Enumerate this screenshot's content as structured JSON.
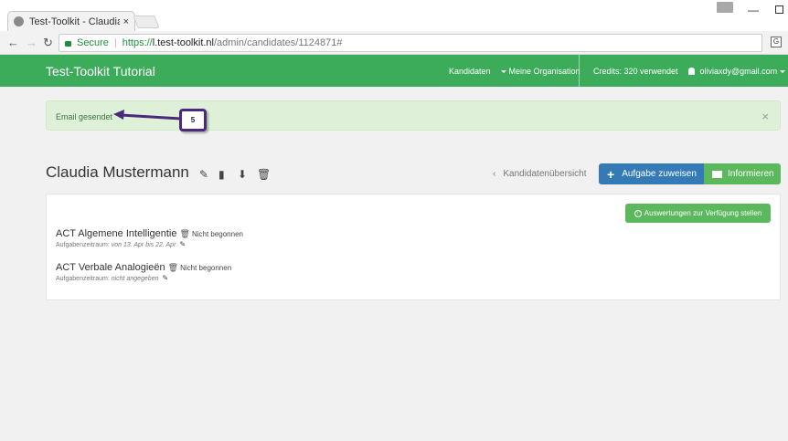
{
  "browser": {
    "tab_title": "Test-Toolkit - Claudia Mu",
    "tab_close": "×",
    "secure_label": "Secure",
    "url_protocol": "https://",
    "url_host": "l.test-toolkit.nl",
    "url_path": "/admin/candidates/1124871#",
    "translate_glyph": "G"
  },
  "navbar": {
    "brand": "Test-Toolkit Tutorial",
    "items": [
      "Kandidaten",
      "Meine Organisation"
    ],
    "credits": "Credits: 320 verwendet",
    "user": "oliviaxdy@gmail.com"
  },
  "alert": {
    "text": "Email gesendet",
    "close": "×"
  },
  "annotation": {
    "step": "5"
  },
  "candidate": {
    "name": "Claudia Mustermann",
    "back_label": "Kandidatenübersicht",
    "assign_label": "Aufgabe zuweisen",
    "inform_label": "Informieren"
  },
  "panel": {
    "eval_button": "Auswertungen zur Verfügung stellen",
    "tasks": [
      {
        "title": "ACT Algemene Intelligentie",
        "status": "Nicht begonnen",
        "period_label": "Aufgabenzeitraum:",
        "period_value": "von 13. Apr bis 22. Apr"
      },
      {
        "title": "ACT Verbale Analogieën",
        "status": "Nicht begonnen",
        "period_label": "Aufgabenzeitraum:",
        "period_value": "nicht angegeben"
      }
    ]
  },
  "colors": {
    "navbar": "#3cac5a",
    "primary": "#337ab7",
    "success": "#5cb85c",
    "alert_bg": "#dff0d8",
    "annotation": "#4a2a7a"
  }
}
